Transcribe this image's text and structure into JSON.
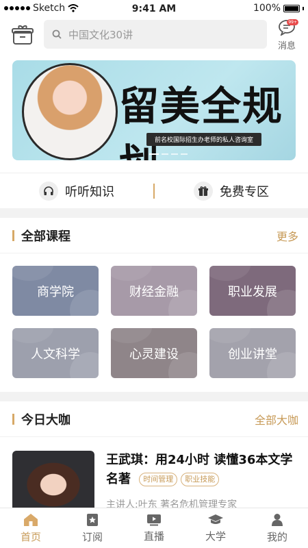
{
  "status_bar": {
    "carrier": "Sketch",
    "time": "9:41 AM",
    "battery": "100%"
  },
  "header": {
    "search_placeholder": "中国文化30讲",
    "messages_label": "消息",
    "messages_badge": "99+"
  },
  "banner": {
    "title": "留美全规划",
    "subtitle": "前名校国际招生办老师的私人咨询室",
    "slides": 4,
    "active_slide": 0
  },
  "quick_links": [
    {
      "label": "听听知识",
      "icon": "headphones-icon"
    },
    {
      "label": "免费专区",
      "icon": "gift-icon"
    }
  ],
  "courses": {
    "title": "全部课程",
    "more": "更多",
    "items": [
      {
        "label": "商学院",
        "color": "#7f8aa3"
      },
      {
        "label": "财经金融",
        "color": "#a79aa8"
      },
      {
        "label": "职业发展",
        "color": "#7e6a7c"
      },
      {
        "label": "人文科学",
        "color": "#9da0ad"
      },
      {
        "label": "心灵建设",
        "color": "#8f8589"
      },
      {
        "label": "创业讲堂",
        "color": "#a3a2ac"
      }
    ]
  },
  "experts": {
    "title": "今日大咖",
    "more": "全部大咖",
    "items": [
      {
        "title": "王武琪：用24小时 读懂36本文学名著",
        "tags": [
          "时间管理",
          "职业技能"
        ],
        "lecturer": "主讲人:叶东 著名危机管理专家"
      }
    ]
  },
  "tabbar": [
    {
      "label": "首页",
      "icon": "home-icon",
      "active": true
    },
    {
      "label": "订阅",
      "icon": "subscribe-icon",
      "active": false
    },
    {
      "label": "直播",
      "icon": "live-icon",
      "active": false
    },
    {
      "label": "大学",
      "icon": "graduation-cap-icon",
      "active": false
    },
    {
      "label": "我的",
      "icon": "profile-icon",
      "active": false
    }
  ],
  "colors": {
    "accent": "#c79a57",
    "badge": "#e84b4b"
  }
}
